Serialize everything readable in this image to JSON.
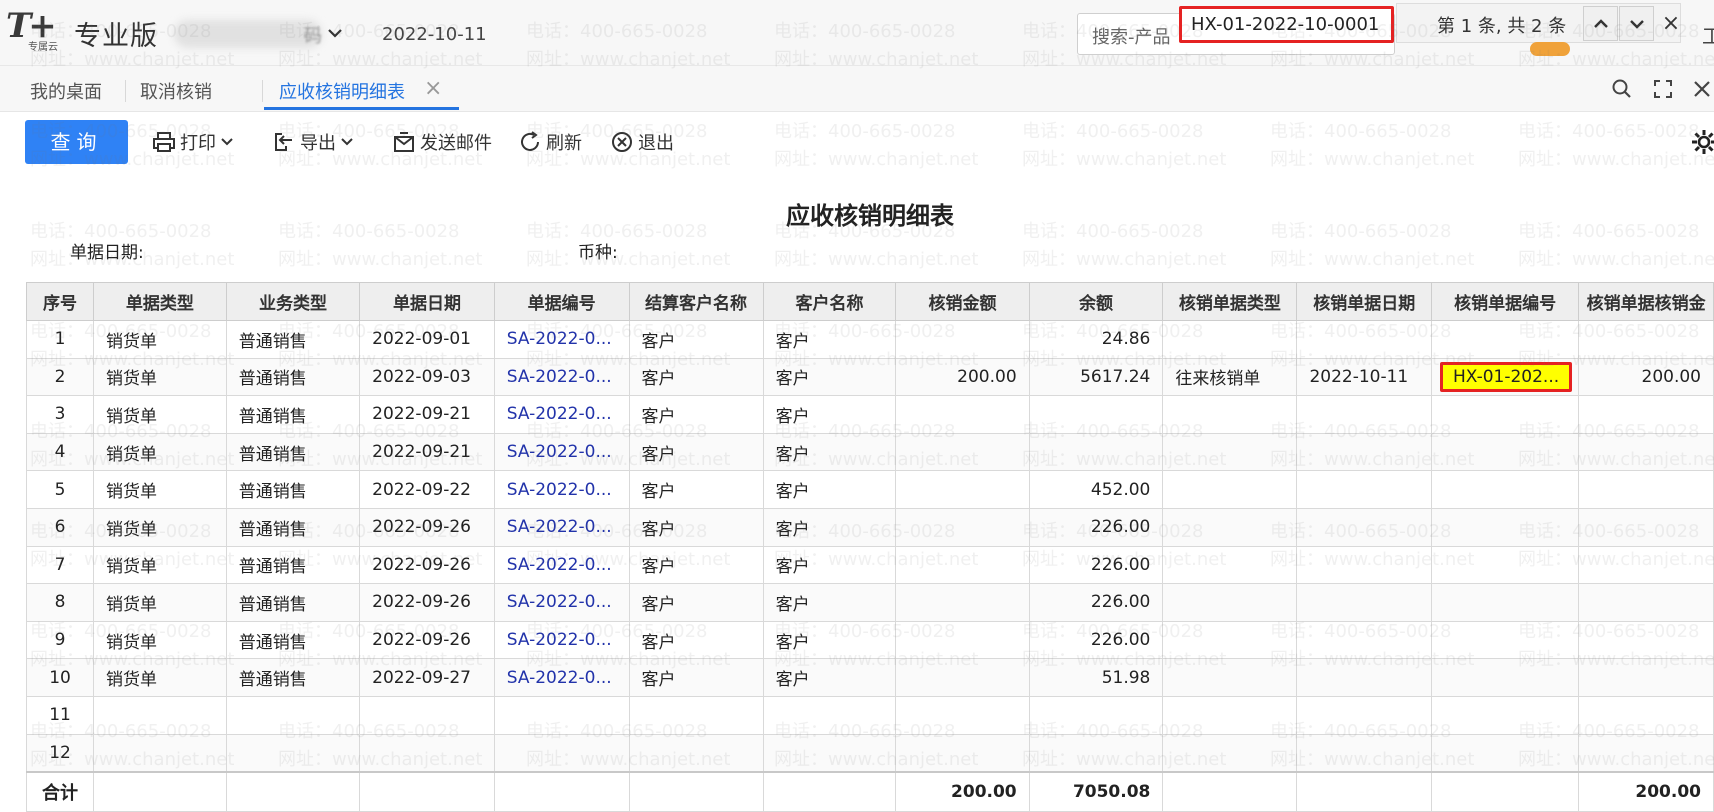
{
  "app": {
    "logo_text": "T+",
    "logo_sub": "专属云",
    "edition": "专业版",
    "account_suffix": "码",
    "login_date": "2022-10-11",
    "search_placeholder": "搜索-产品",
    "edge_char": "工"
  },
  "find": {
    "value": "HX-01-2022-10-0001",
    "count": "第 1 条, 共 2 条",
    "close": "×"
  },
  "tabs": {
    "desktop": "我的桌面",
    "cancel": "取消核销",
    "active": "应收核销明细表",
    "close": "×"
  },
  "toolbar": {
    "query": "查询",
    "print": "打印",
    "export": "导出",
    "email": "发送邮件",
    "refresh": "刷新",
    "exit": "退出"
  },
  "report": {
    "title": "应收核销明细表",
    "cond_date_label": "单据日期:",
    "cond_currency_label": "币种:"
  },
  "table": {
    "columns": [
      "序号",
      "单据类型",
      "业务类型",
      "单据日期",
      "单据编号",
      "结算客户名称",
      "客户名称",
      "核销金额",
      "余额",
      "核销单据类型",
      "核销单据日期",
      "核销单据编号",
      "核销单据核销金"
    ],
    "rows": [
      [
        "1",
        "销货单",
        "普通销售",
        "2022-09-01",
        "SA-2022-0...",
        "客户",
        "客户",
        "",
        "24.86",
        "",
        "",
        "",
        ""
      ],
      [
        "2",
        "销货单",
        "普通销售",
        "2022-09-03",
        "SA-2022-0...",
        "客户",
        "客户",
        "200.00",
        "5617.24",
        "往来核销单",
        "2022-10-11",
        "HX-01-202...",
        "200.00"
      ],
      [
        "3",
        "销货单",
        "普通销售",
        "2022-09-21",
        "SA-2022-0...",
        "客户",
        "客户",
        "",
        "",
        "",
        "",
        "",
        ""
      ],
      [
        "4",
        "销货单",
        "普通销售",
        "2022-09-21",
        "SA-2022-0...",
        "客户",
        "客户",
        "",
        "",
        "",
        "",
        "",
        ""
      ],
      [
        "5",
        "销货单",
        "普通销售",
        "2022-09-22",
        "SA-2022-0...",
        "客户",
        "客户",
        "",
        "452.00",
        "",
        "",
        "",
        ""
      ],
      [
        "6",
        "销货单",
        "普通销售",
        "2022-09-26",
        "SA-2022-0...",
        "客户",
        "客户",
        "",
        "226.00",
        "",
        "",
        "",
        ""
      ],
      [
        "7",
        "销货单",
        "普通销售",
        "2022-09-26",
        "SA-2022-0...",
        "客户",
        "客户",
        "",
        "226.00",
        "",
        "",
        "",
        ""
      ],
      [
        "8",
        "销货单",
        "普通销售",
        "2022-09-26",
        "SA-2022-0...",
        "客户",
        "客户",
        "",
        "226.00",
        "",
        "",
        "",
        ""
      ],
      [
        "9",
        "销货单",
        "普通销售",
        "2022-09-26",
        "SA-2022-0...",
        "客户",
        "客户",
        "",
        "226.00",
        "",
        "",
        "",
        ""
      ],
      [
        "10",
        "销货单",
        "普通销售",
        "2022-09-27",
        "SA-2022-0...",
        "客户",
        "客户",
        "",
        "51.98",
        "",
        "",
        "",
        ""
      ],
      [
        "11",
        "",
        "",
        "",
        "",
        "",
        "",
        "",
        "",
        "",
        "",
        "",
        ""
      ],
      [
        "12",
        "",
        "",
        "",
        "",
        "",
        "",
        "",
        "",
        "",
        "",
        "",
        ""
      ]
    ],
    "total_label": "合计",
    "total_amount": "200.00",
    "total_balance": "7050.08",
    "total_writeoff": "200.00"
  },
  "watermark": {
    "phone": "电话：400-665-0028",
    "site": "网址：www.chanjet.net"
  },
  "colors": {
    "accent": "#2474e0",
    "query_button": "#2f82f5",
    "highlight_border": "#e52222",
    "highlight_fill": "#ffff00",
    "link": "#2233aa"
  }
}
